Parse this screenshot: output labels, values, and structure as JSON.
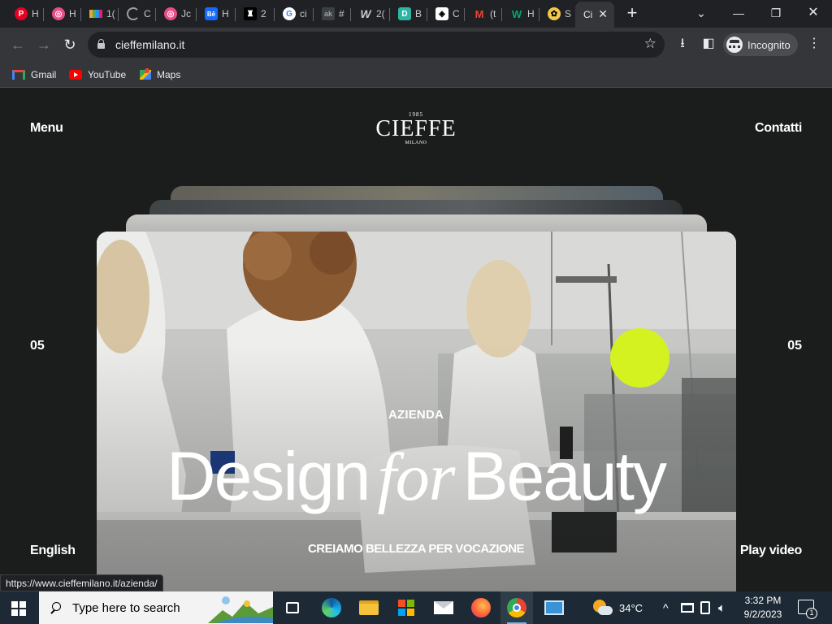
{
  "browser": {
    "tabs": [
      {
        "title": "H",
        "icon": "pinterest-icon",
        "color": "#e60023"
      },
      {
        "title": "H",
        "icon": "dribbble-icon",
        "color": "#ea4c89"
      },
      {
        "title": "1(",
        "icon": "bars-logo-icon",
        "color": "#e8a33d"
      },
      {
        "title": "C",
        "icon": "spinner-icon",
        "color": "#9aa0a6"
      },
      {
        "title": "Jc",
        "icon": "dribbble-icon",
        "color": "#ea4c89"
      },
      {
        "title": "H",
        "icon": "behance-icon",
        "color": "#1769ff"
      },
      {
        "title": "2",
        "icon": "crown-icon",
        "color": "#000000"
      },
      {
        "title": "ci",
        "icon": "google-icon",
        "color": "#4285f4"
      },
      {
        "title": "#",
        "icon": "grid-icon",
        "color": "#5f6368"
      },
      {
        "title": "2(",
        "icon": "w-logo-icon",
        "color": "#9aa0a6"
      },
      {
        "title": "B",
        "icon": "d-logo-icon",
        "color": "#2bb6a3"
      },
      {
        "title": "C",
        "icon": "cube-icon",
        "color": "#ffffff"
      },
      {
        "title": "(t",
        "icon": "gmail-icon",
        "color": "#ea4335"
      },
      {
        "title": "H",
        "icon": "webflow-icon",
        "color": "#00a86b"
      },
      {
        "title": "S",
        "icon": "paw-icon",
        "color": "#f2c94c"
      },
      {
        "title": "Ci",
        "icon": "blank-icon",
        "color": "#35363a",
        "active": true
      }
    ],
    "new_tab_label": "+",
    "address": "cieffemilano.it",
    "profile_label": "Incognito",
    "bookmarks": [
      {
        "label": "Gmail",
        "icon": "gmail-icon"
      },
      {
        "label": "YouTube",
        "icon": "youtube-icon"
      },
      {
        "label": "Maps",
        "icon": "maps-icon"
      }
    ],
    "status_url": "https://www.cieffemilano.it/azienda/"
  },
  "site": {
    "menu_label": "Menu",
    "contact_label": "Contatti",
    "logo": {
      "year": "1985",
      "name": "CIEFFE",
      "city": "MILANO"
    },
    "left_counter": "05",
    "right_counter": "05",
    "language_label": "English",
    "play_label": "Play video",
    "eyebrow": "AZIENDA",
    "headline_before": "Design",
    "headline_italic": "for",
    "headline_after": "Beauty",
    "subline": "CREIAMO BELLEZZA PER VOCAZIONE",
    "accent_color": "#d4f21f"
  },
  "taskbar": {
    "search_placeholder": "Type here to search",
    "apps": [
      "task-view-icon",
      "edge-icon",
      "file-explorer-icon",
      "store-icon",
      "mail-icon",
      "firefox-icon",
      "chrome-icon",
      "remote-desktop-icon"
    ],
    "temperature": "34°C",
    "time": "3:32 PM",
    "date": "9/2/2023",
    "notification_count": "1"
  }
}
